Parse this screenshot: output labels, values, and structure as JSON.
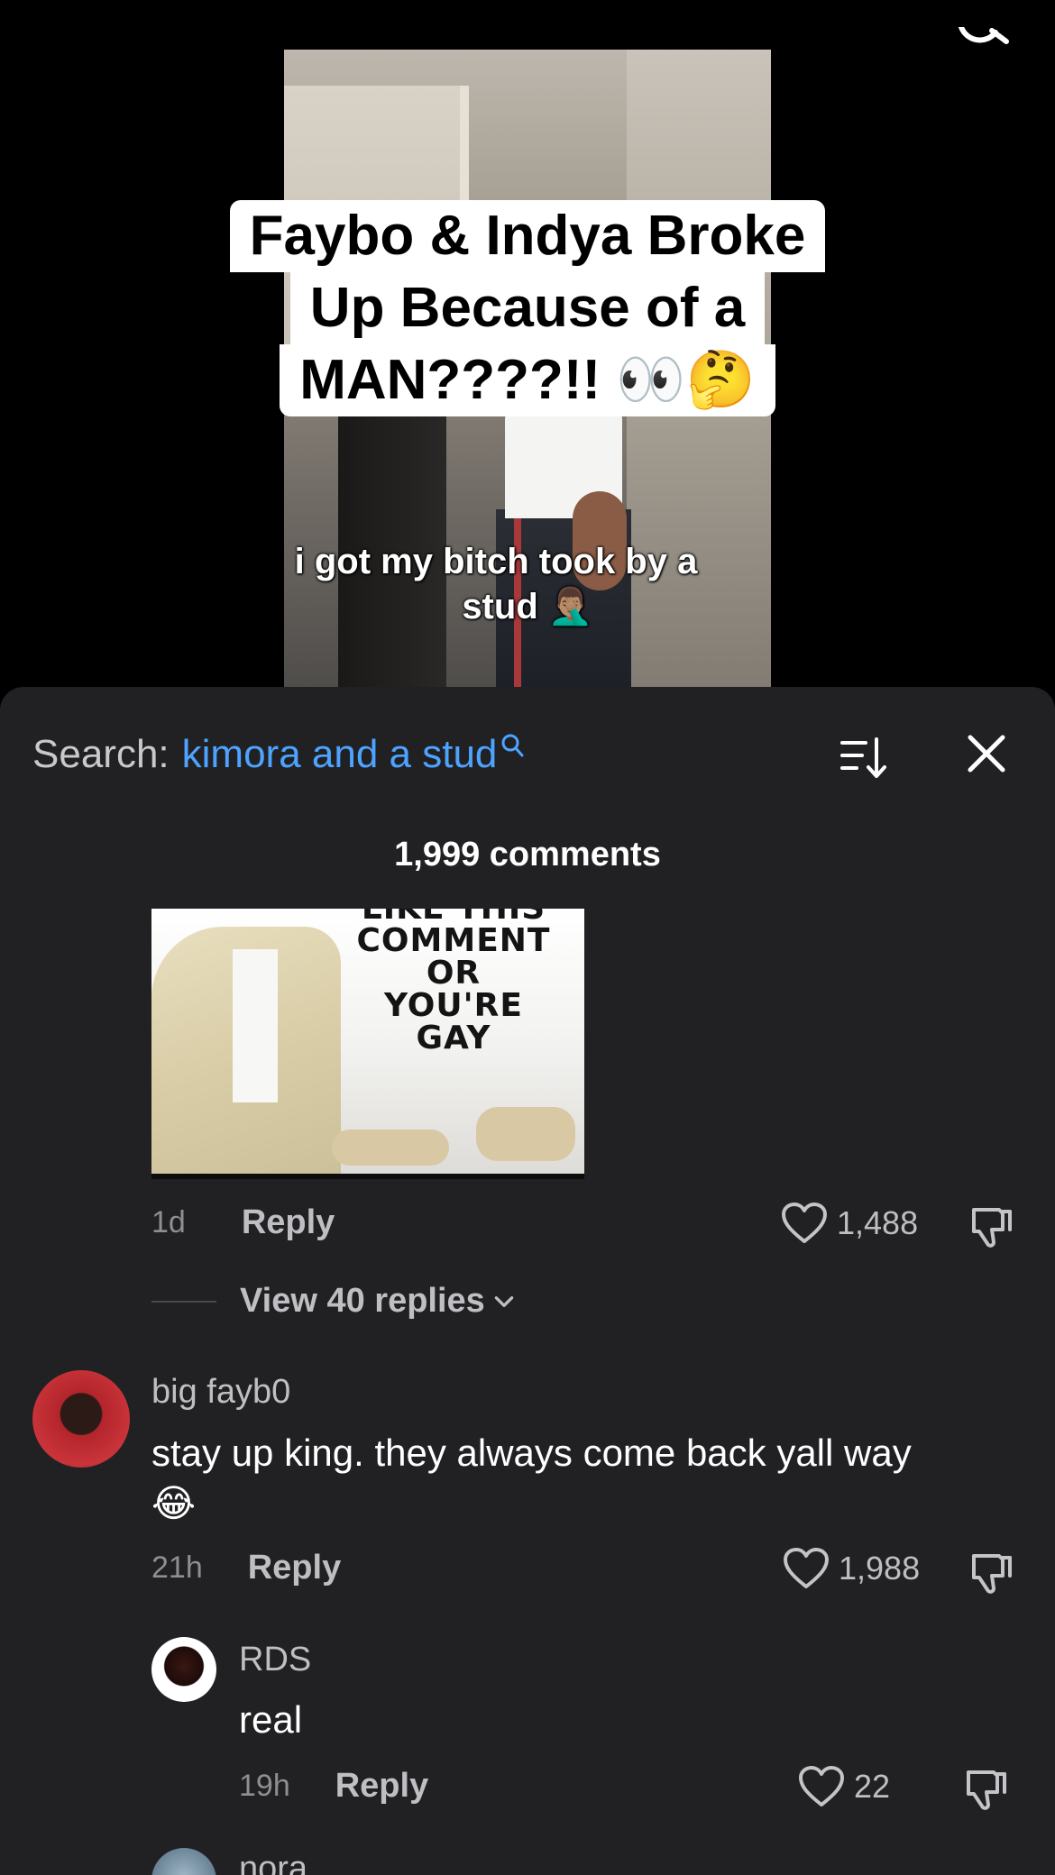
{
  "video": {
    "title_lines": [
      "Faybo & Indya Broke",
      "Up Because of a",
      "MAN????!! 👀🤔"
    ],
    "caption_line1": "i got my bitch took by a",
    "caption_line2": "stud 🤦🏽‍♂️"
  },
  "comments_sheet": {
    "search_label": "Search:",
    "search_term": "kimora and a stud",
    "comment_count": "1,999 comments",
    "sort_icon": "sort-descending-icon",
    "close_icon": "close-icon"
  },
  "first_comment": {
    "image_text": [
      "LIKE THIS",
      "COMMENT",
      "OR",
      "YOU'RE",
      "GAY"
    ],
    "time": "1d",
    "reply_label": "Reply",
    "likes": "1,488",
    "view_replies": "View 40 replies"
  },
  "comments": [
    {
      "username": "big fayb0",
      "text": "stay up king. they always come back yall way",
      "emoji": "😂",
      "time": "21h",
      "reply_label": "Reply",
      "likes": "1,988"
    },
    {
      "username": "RDS",
      "text": "real",
      "time": "19h",
      "reply_label": "Reply",
      "likes": "22"
    },
    {
      "username": "nora"
    }
  ],
  "colors": {
    "sheet_bg": "#212123",
    "accent_blue": "#4da3ff",
    "muted_text": "#8e8e93"
  }
}
